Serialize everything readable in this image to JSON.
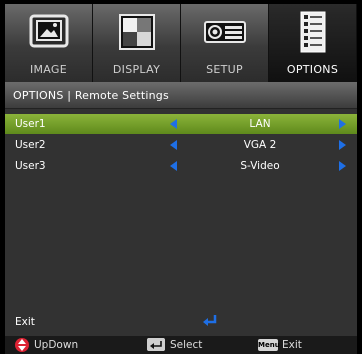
{
  "tabs": [
    {
      "label": "IMAGE",
      "icon": "image-icon"
    },
    {
      "label": "DISPLAY",
      "icon": "display-icon"
    },
    {
      "label": "SETUP",
      "icon": "setup-icon"
    },
    {
      "label": "OPTIONS",
      "icon": "options-icon",
      "active": true
    }
  ],
  "breadcrumb": "OPTIONS | Remote Settings",
  "rows": [
    {
      "name": "User1",
      "value": "LAN",
      "selected": true
    },
    {
      "name": "User2",
      "value": "VGA 2",
      "selected": false
    },
    {
      "name": "User3",
      "value": "S-Video",
      "selected": false
    }
  ],
  "exit_label": "Exit",
  "footer": {
    "updown": "UpDown",
    "select": "Select",
    "menu_key": "Menu",
    "exit": "Exit"
  },
  "colors": {
    "selected_row": "#7aa52e",
    "arrow_blue": "#1e6fe6",
    "panel_bg": "#323232"
  }
}
